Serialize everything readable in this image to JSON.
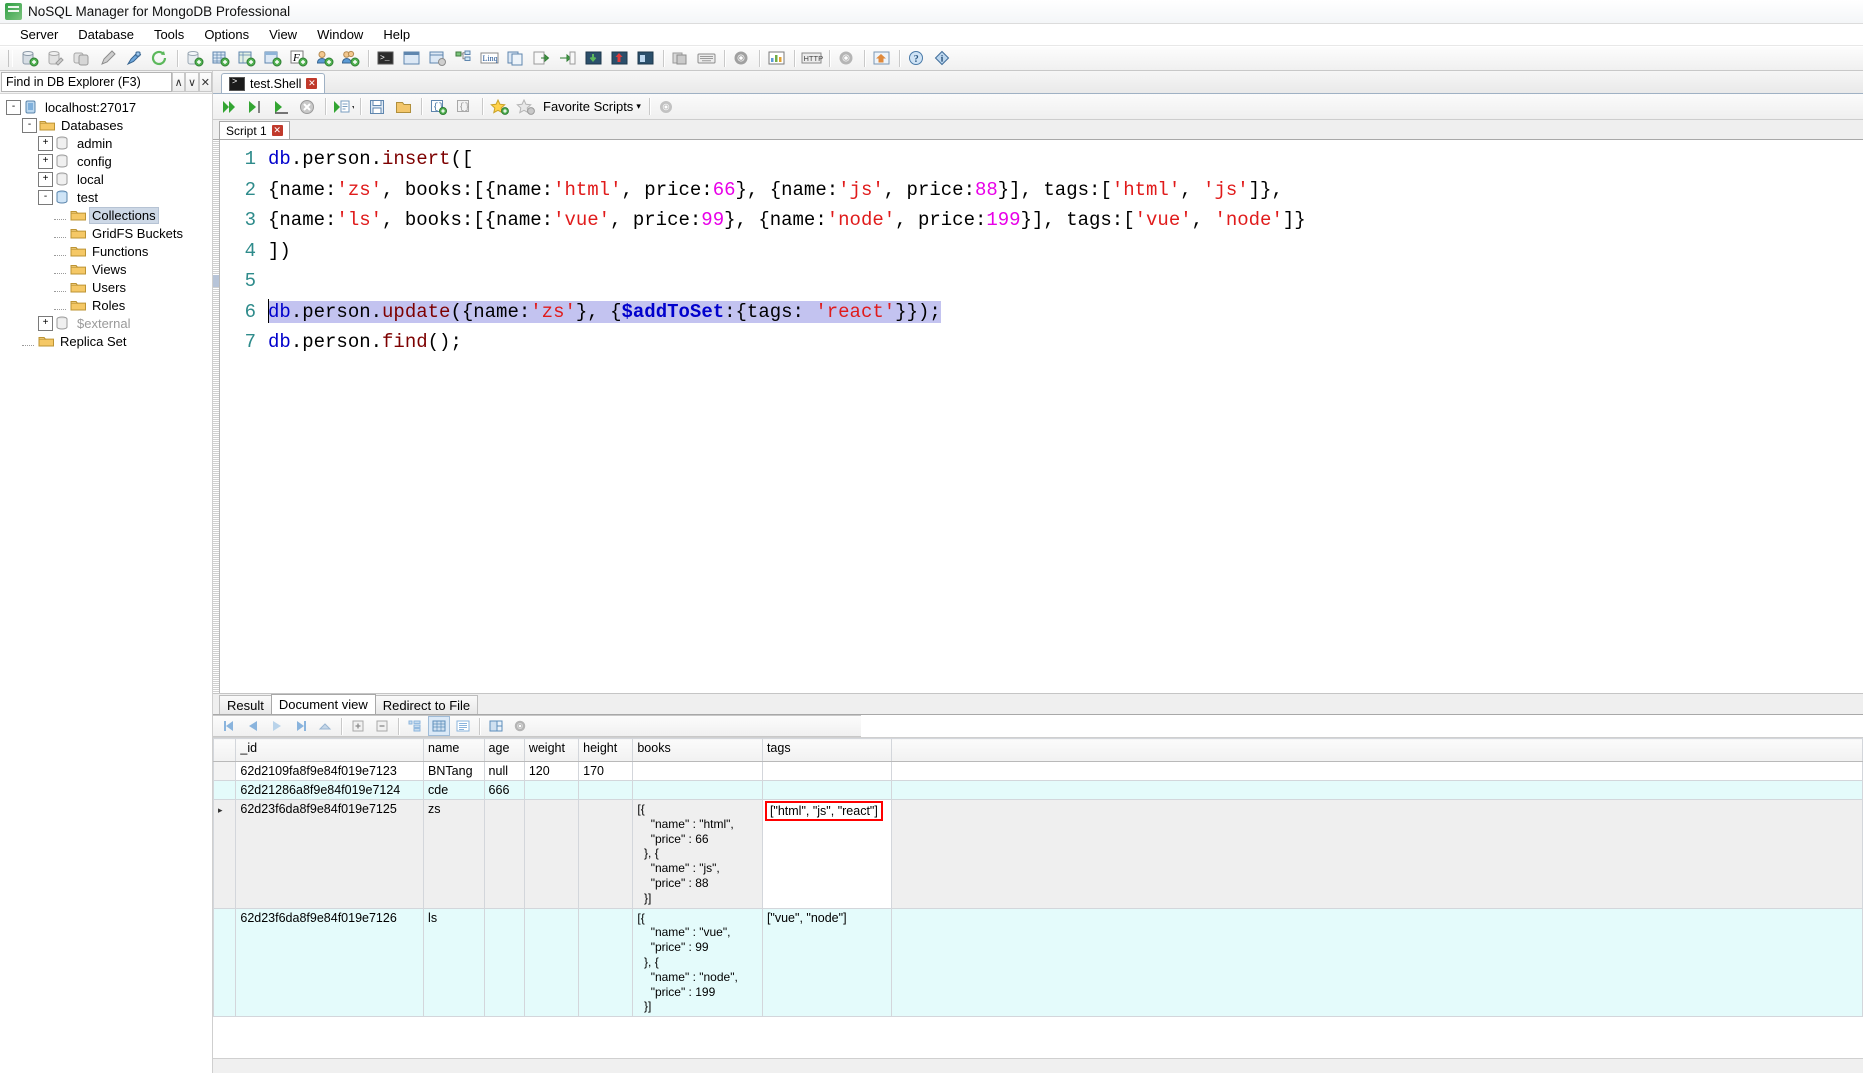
{
  "window": {
    "title": "NoSQL Manager for MongoDB Professional",
    "icon": "app-icon"
  },
  "menu": {
    "items": [
      {
        "label": "Server"
      },
      {
        "label": "Database"
      },
      {
        "label": "Tools"
      },
      {
        "label": "Options"
      },
      {
        "label": "View"
      },
      {
        "label": "Window"
      },
      {
        "label": "Help"
      }
    ]
  },
  "toolbar": {
    "groups": [
      [
        "add-database-icon",
        "edit-database-icon",
        "copy-database-icon",
        "edit-pencil-icon",
        "connect-plug-icon",
        "refresh-icon"
      ],
      [
        "new-collection-icon",
        "new-table-icon",
        "new-index-icon",
        "new-view-icon",
        "new-function-icon",
        "new-user-icon",
        "new-role-icon"
      ],
      [
        "shell-console-icon",
        "window-icon",
        "settings-window-icon",
        "tree-diagram-icon",
        "linq-icon",
        "documents-icon",
        "export-icon",
        "import-icon",
        "download-db-icon",
        "backup-db-icon",
        "restore-db-icon"
      ],
      [
        "layers-icon",
        "keyboard-icon"
      ],
      [
        "gear-icon"
      ],
      [
        "monitor-chart-icon"
      ],
      [
        "http-icon"
      ],
      [
        "options-gear-icon"
      ],
      [
        "home-icon"
      ],
      [
        "help-icon",
        "info-icon"
      ]
    ]
  },
  "explorer": {
    "find": {
      "value": "Find in DB Explorer (F3)",
      "placeholder": "Find in DB Explorer (F3)",
      "up_label": "∧",
      "down_label": "∨",
      "close_label": "✕"
    },
    "tree": [
      {
        "label": "localhost:27017",
        "depth": 0,
        "expander": "-",
        "icon": "server-icon",
        "selected": false,
        "dim": false
      },
      {
        "label": "Databases",
        "depth": 1,
        "expander": "-",
        "icon": "folder-icon",
        "selected": false,
        "dim": false
      },
      {
        "label": "admin",
        "depth": 2,
        "expander": "+",
        "icon": "database-icon",
        "selected": false,
        "dim": false
      },
      {
        "label": "config",
        "depth": 2,
        "expander": "+",
        "icon": "database-icon",
        "selected": false,
        "dim": false
      },
      {
        "label": "local",
        "depth": 2,
        "expander": "+",
        "icon": "database-icon",
        "selected": false,
        "dim": false
      },
      {
        "label": "test",
        "depth": 2,
        "expander": "-",
        "icon": "database-active-icon",
        "selected": false,
        "dim": false
      },
      {
        "label": "Collections",
        "depth": 3,
        "expander": "",
        "icon": "folder-icon",
        "selected": true,
        "dim": false
      },
      {
        "label": "GridFS Buckets",
        "depth": 3,
        "expander": "",
        "icon": "folder-icon",
        "selected": false,
        "dim": false
      },
      {
        "label": "Functions",
        "depth": 3,
        "expander": "",
        "icon": "folder-icon",
        "selected": false,
        "dim": false
      },
      {
        "label": "Views",
        "depth": 3,
        "expander": "",
        "icon": "folder-icon",
        "selected": false,
        "dim": false
      },
      {
        "label": "Users",
        "depth": 3,
        "expander": "",
        "icon": "folder-icon",
        "selected": false,
        "dim": false
      },
      {
        "label": "Roles",
        "depth": 3,
        "expander": "",
        "icon": "folder-icon",
        "selected": false,
        "dim": false
      },
      {
        "label": "$external",
        "depth": 2,
        "expander": "+",
        "icon": "database-icon",
        "selected": false,
        "dim": true
      },
      {
        "label": "Replica Set",
        "depth": 1,
        "expander": "",
        "icon": "folder-icon",
        "selected": false,
        "dim": false
      }
    ]
  },
  "document_tabs": [
    {
      "label": "test.Shell",
      "active": true,
      "close": "✕"
    }
  ],
  "script_toolbar": {
    "buttons": [
      "run-all-icon",
      "run-current-icon",
      "run-block-icon",
      "stop-icon",
      "run-with-options-icon",
      "save-script-icon",
      "open-script-icon",
      "format-braces-icon",
      "comment-braces-icon",
      "add-favorite-icon",
      "remove-favorite-icon"
    ],
    "favorite_scripts_label": "Favorite Scripts",
    "favorite_dropdown_caret": "▾",
    "settings_icon": "gear-icon"
  },
  "script_tabs": [
    {
      "label": "Script 1",
      "active": true,
      "close": "✕"
    }
  ],
  "editor": {
    "lines": [
      {
        "n": "1",
        "selected": false,
        "tokens": [
          {
            "t": "db",
            "c": "kw"
          },
          {
            "t": ".person.",
            "c": "plain"
          },
          {
            "t": "insert",
            "c": "fn"
          },
          {
            "t": "([",
            "c": "plain"
          }
        ]
      },
      {
        "n": "2",
        "selected": false,
        "tokens": [
          {
            "t": "{name:",
            "c": "plain"
          },
          {
            "t": "'zs'",
            "c": "str"
          },
          {
            "t": ", books:[{name:",
            "c": "plain"
          },
          {
            "t": "'html'",
            "c": "str"
          },
          {
            "t": ", price:",
            "c": "plain"
          },
          {
            "t": "66",
            "c": "num"
          },
          {
            "t": "}, {name:",
            "c": "plain"
          },
          {
            "t": "'js'",
            "c": "str"
          },
          {
            "t": ", price:",
            "c": "plain"
          },
          {
            "t": "88",
            "c": "num"
          },
          {
            "t": "}], tags:[",
            "c": "plain"
          },
          {
            "t": "'html'",
            "c": "str"
          },
          {
            "t": ", ",
            "c": "plain"
          },
          {
            "t": "'js'",
            "c": "str"
          },
          {
            "t": "]},",
            "c": "plain"
          }
        ]
      },
      {
        "n": "3",
        "selected": false,
        "tokens": [
          {
            "t": "{name:",
            "c": "plain"
          },
          {
            "t": "'ls'",
            "c": "str"
          },
          {
            "t": ", books:[{name:",
            "c": "plain"
          },
          {
            "t": "'vue'",
            "c": "str"
          },
          {
            "t": ", price:",
            "c": "plain"
          },
          {
            "t": "99",
            "c": "num"
          },
          {
            "t": "}, {name:",
            "c": "plain"
          },
          {
            "t": "'node'",
            "c": "str"
          },
          {
            "t": ", price:",
            "c": "plain"
          },
          {
            "t": "199",
            "c": "num"
          },
          {
            "t": "}], tags:[",
            "c": "plain"
          },
          {
            "t": "'vue'",
            "c": "str"
          },
          {
            "t": ", ",
            "c": "plain"
          },
          {
            "t": "'node'",
            "c": "str"
          },
          {
            "t": "]}",
            "c": "plain"
          }
        ]
      },
      {
        "n": "4",
        "selected": false,
        "tokens": [
          {
            "t": "])",
            "c": "plain"
          }
        ]
      },
      {
        "n": "5",
        "selected": false,
        "tokens": []
      },
      {
        "n": "6",
        "selected": true,
        "caret": true,
        "tokens": [
          {
            "t": "db",
            "c": "kw"
          },
          {
            "t": ".person.",
            "c": "plain"
          },
          {
            "t": "update",
            "c": "fn"
          },
          {
            "t": "({name:",
            "c": "plain"
          },
          {
            "t": "'zs'",
            "c": "str"
          },
          {
            "t": "}, {",
            "c": "plain"
          },
          {
            "t": "$addToSet",
            "c": "op"
          },
          {
            "t": ":{tags: ",
            "c": "plain"
          },
          {
            "t": "'react'",
            "c": "str"
          },
          {
            "t": "}});",
            "c": "plain"
          }
        ]
      },
      {
        "n": "7",
        "selected": false,
        "tokens": [
          {
            "t": "db",
            "c": "kw"
          },
          {
            "t": ".person.",
            "c": "plain"
          },
          {
            "t": "find",
            "c": "fn"
          },
          {
            "t": "();",
            "c": "plain"
          }
        ]
      }
    ]
  },
  "result": {
    "tabs": [
      {
        "label": "Result",
        "active": false
      },
      {
        "label": "Document view",
        "active": true
      },
      {
        "label": "Redirect to File",
        "active": false
      }
    ],
    "grid_toolbar": [
      "first-record-icon",
      "previous-record-icon",
      "next-record-icon",
      "last-record-icon",
      "collapse-icon",
      "add-record-icon",
      "delete-record-icon",
      "tree-view-icon",
      "table-view-icon",
      "text-view-icon",
      "split-view-icon",
      "grid-settings-icon"
    ],
    "columns": [
      "_id",
      "name",
      "age",
      "weight",
      "height",
      "books",
      "tags"
    ],
    "rows": [
      {
        "_id": "62d2109fa8f9e84f019e7123",
        "name": "BNTang",
        "age": "null",
        "weight": "120",
        "height": "170",
        "books": "",
        "tags": "",
        "style": "normal",
        "marker": ""
      },
      {
        "_id": "62d21286a8f9e84f019e7124",
        "name": "cde",
        "age": "666",
        "weight": "",
        "height": "",
        "books": "",
        "tags": "",
        "style": "alt",
        "marker": ""
      },
      {
        "_id": "62d23f6da8f9e84f019e7125",
        "name": "zs",
        "age": "",
        "weight": "",
        "height": "",
        "books": "[{\n    \"name\" : \"html\",\n    \"price\" : 66\n  }, {\n    \"name\" : \"js\",\n    \"price\" : 88\n  }]",
        "tags": "[\"html\", \"js\", \"react\"]",
        "style": "selected",
        "marker": "▸",
        "tags_highlight": true
      },
      {
        "_id": "62d23f6da8f9e84f019e7126",
        "name": "ls",
        "age": "",
        "weight": "",
        "height": "",
        "books": "[{\n    \"name\" : \"vue\",\n    \"price\" : 99\n  }, {\n    \"name\" : \"node\",\n    \"price\" : 199\n  }]",
        "tags": "[\"vue\", \"node\"]",
        "style": "alt",
        "marker": ""
      }
    ]
  },
  "colors": {
    "keyword": "#0000cc",
    "function": "#7d0000",
    "string": "#e01b1b",
    "number": "#e800e8",
    "selection": "#c3c3f0",
    "highlight_box": "#ff0000",
    "alt_row": "#e4fbfb",
    "selected_row": "#efefef",
    "tree_selection": "#cdd8e6"
  }
}
